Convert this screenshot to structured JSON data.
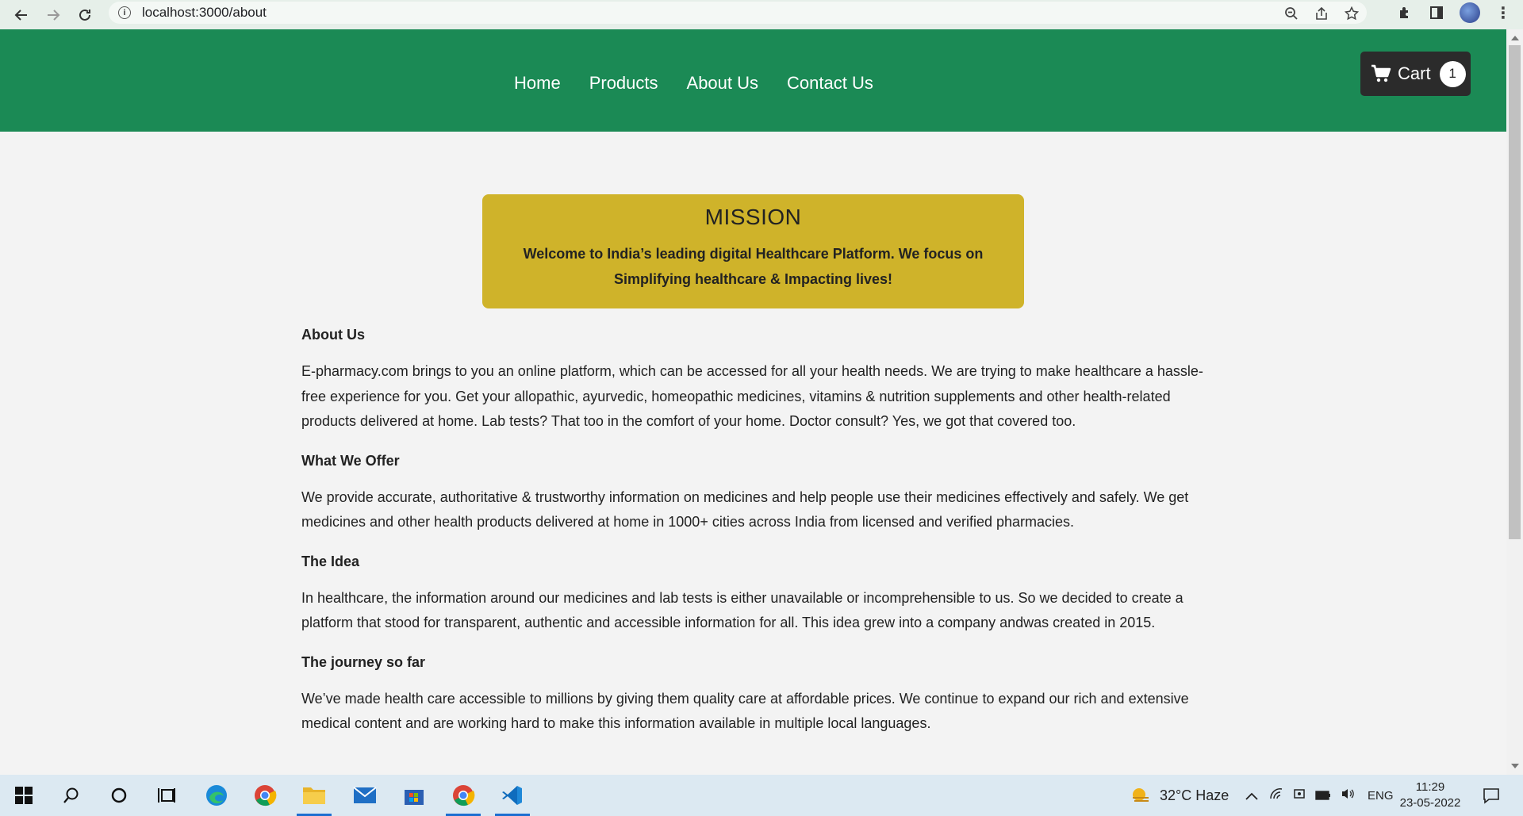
{
  "browser": {
    "url": "localhost:3000/about"
  },
  "nav": {
    "items": [
      "Home",
      "Products",
      "About Us",
      "Contact Us"
    ],
    "cart_label": "Cart",
    "cart_count": "1"
  },
  "mission": {
    "title": "MISSION",
    "text": "Welcome to India’s leading digital Healthcare Platform. We focus on Simplifying healthcare & Impacting lives!"
  },
  "sections": [
    {
      "title": "About Us",
      "body": "E-pharmacy.com brings to you an online platform, which can be accessed for all your health needs. We are trying to make healthcare a hassle-free experience for you. Get your allopathic, ayurvedic, homeopathic medicines, vitamins & nutrition supplements and other health-related products delivered at home. Lab tests? That too in the comfort of your home. Doctor consult? Yes, we got that covered too."
    },
    {
      "title": "What We Offer",
      "body": "We provide accurate, authoritative & trustworthy information on medicines and help people use their medicines effectively and safely. We get medicines and other health products delivered at home in 1000+ cities across India from licensed and verified pharmacies."
    },
    {
      "title": "The Idea",
      "body": "In healthcare, the information around our medicines and lab tests is either unavailable or incomprehensible to us. So we decided to create a platform that stood for transparent, authentic and accessible information for all. This idea grew into a company andwas created in 2015."
    },
    {
      "title": "The journey so far",
      "body": "We’ve made health care accessible to millions by giving them quality care at affordable prices. We continue to expand our rich and extensive medical content and are working hard to make this information available in multiple local languages."
    }
  ],
  "taskbar": {
    "weather": "32°C  Haze",
    "language": "ENG",
    "time": "11:29",
    "date": "23-05-2022"
  },
  "colors": {
    "header_green": "#1b8a55",
    "mission_gold": "#cfb32a",
    "cart_dark": "#2b2b2b"
  }
}
